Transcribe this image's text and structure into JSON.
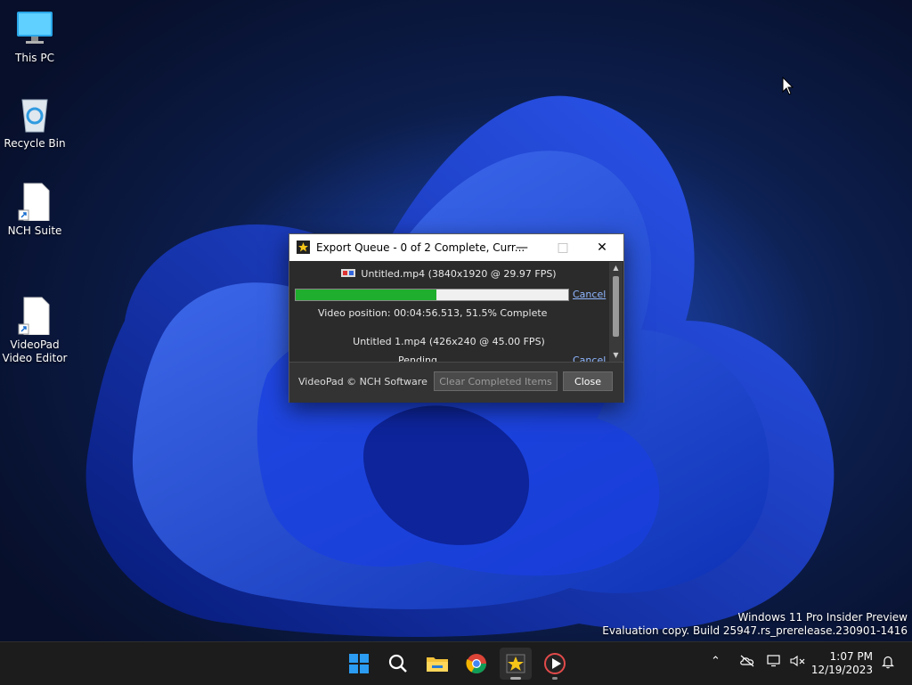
{
  "desktop": {
    "icons": [
      {
        "label": "This PC"
      },
      {
        "label": "Recycle Bin"
      },
      {
        "label": "NCH Suite"
      },
      {
        "label": "VideoPad\nVideo Editor"
      }
    ],
    "watermark": {
      "line1": "Windows 11 Pro Insider Preview",
      "line2": "Evaluation copy. Build 25947.rs_prerelease.230901-1416"
    }
  },
  "window": {
    "title": "Export Queue - 0 of 2 Complete, Curr...",
    "items": [
      {
        "title": "Untitled.mp4 (3840x1920 @ 29.97 FPS)",
        "progress_percent": 51.5,
        "status": "Video position:  00:04:56.513, 51.5% Complete",
        "cancel_label": "Cancel"
      },
      {
        "title": "Untitled 1.mp4 (426x240 @ 45.00 FPS)",
        "status": "Pending",
        "cancel_label": "Cancel"
      }
    ],
    "footer": {
      "copyright": "VideoPad © NCH Software",
      "clear_label": "Clear Completed Items",
      "close_label": "Close"
    }
  },
  "taskbar": {
    "time": "1:07 PM",
    "date": "12/19/2023",
    "items": [
      "windows-start",
      "search",
      "file-explorer",
      "chrome",
      "videopad",
      "media-player"
    ]
  },
  "colors": {
    "progress_fill": "#1fae2d",
    "link": "#8fb6ff",
    "accent_blue": "#0a64ff"
  }
}
